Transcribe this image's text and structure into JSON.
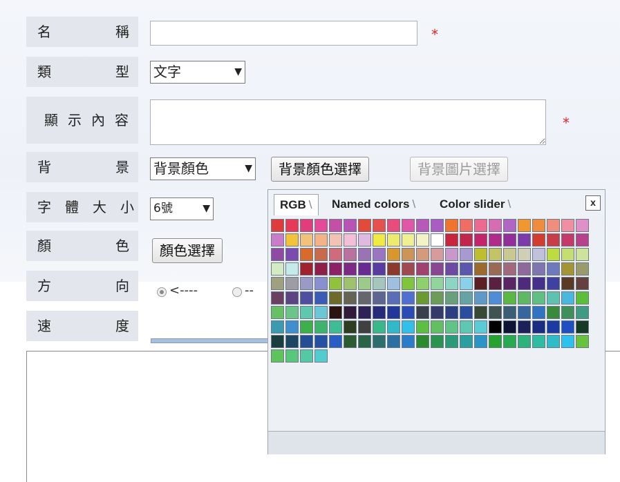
{
  "form": {
    "name": {
      "label_chars": [
        "名",
        "稱"
      ],
      "value": "",
      "required": "*"
    },
    "type": {
      "label_chars": [
        "類",
        "型"
      ],
      "selected": "文字",
      "arrow": "▼"
    },
    "content": {
      "label_chars": [
        "顯",
        "示",
        "內",
        "容"
      ],
      "value": "",
      "required": "*"
    },
    "background": {
      "label_chars": [
        "背",
        "景"
      ],
      "selected": "背景顏色",
      "arrow": "▼",
      "color_button": "背景顏色選擇",
      "image_button": "背景圖片選擇"
    },
    "font_size": {
      "label_chars": [
        "字",
        "體",
        "大",
        "小"
      ],
      "selected": "6號",
      "arrow": "▼"
    },
    "color": {
      "label_chars": [
        "顏",
        "色"
      ],
      "button": "顏色選擇"
    },
    "direction": {
      "label_chars": [
        "方",
        "向"
      ],
      "option1": "<----",
      "option2": "--"
    },
    "speed": {
      "label_chars": [
        "速",
        "度"
      ]
    }
  },
  "color_picker": {
    "tabs": [
      "RGB",
      "Named colors",
      "Color slider"
    ],
    "close": "x",
    "swatches": [
      "#e03b3b",
      "#e83a56",
      "#e23d7b",
      "#e44a99",
      "#c44fa6",
      "#b754b6",
      "#e34a3a",
      "#e6504d",
      "#e94b7d",
      "#e057a8",
      "#b858b8",
      "#a95cc2",
      "#f0732e",
      "#ef6d62",
      "#ec6991",
      "#d56cb4",
      "#b066c5",
      "#f0972f",
      "#f08c3e",
      "#f08e7d",
      "#ef8fa1",
      "#e08fc8",
      "#c97dc9",
      "#f2c23a",
      "#f0c27c",
      "#f3b387",
      "#f2c2b4",
      "#f2bfd7",
      "#e0b9e0",
      "#f0ea42",
      "#eeea6e",
      "#f0ef94",
      "#f4f3c5",
      "#ffffff",
      "#c9253d",
      "#c2264a",
      "#c3246b",
      "#b12c8a",
      "#932e9a",
      "#7c3ba8",
      "#d13d2f",
      "#c73e49",
      "#c53a69",
      "#b7418a",
      "#8f4aa3",
      "#7a4aae",
      "#d86a2b",
      "#c96a4d",
      "#d06c7a",
      "#bb71a0",
      "#9b73b5",
      "#9a76c2",
      "#d8962e",
      "#cd9457",
      "#d49a7b",
      "#d79b9b",
      "#c798c9",
      "#a79ad0",
      "#bfbe2e",
      "#c3c467",
      "#c9c98f",
      "#cfcfb8",
      "#c1c1dc",
      "#bcdc3f",
      "#c6dd73",
      "#cde39b",
      "#d3ebc2",
      "#c5eaea",
      "#a0222d",
      "#8e1f46",
      "#8e2166",
      "#7e2a85",
      "#6a2a93",
      "#5a3ba0",
      "#8c3a2a",
      "#a04a50",
      "#a0416f",
      "#8a4690",
      "#6c4aa1",
      "#5b56ae",
      "#9c6a2c",
      "#9a6a55",
      "#a2687c",
      "#8e6999",
      "#7f75b0",
      "#6f7abc",
      "#a49534",
      "#9b9a6c",
      "#a0a07f",
      "#9c9ca2",
      "#9a9ac4",
      "#8a8fd0",
      "#92c23c",
      "#a0c26c",
      "#9ccb89",
      "#a4c6bd",
      "#9fbfdf",
      "#7fc63c",
      "#8ed06c",
      "#93d39c",
      "#8ed4c4",
      "#8ad0e8",
      "#5e1f22",
      "#5a203f",
      "#5b2462",
      "#4f2a7b",
      "#45308c",
      "#3f41a0",
      "#5a3a23",
      "#64413f",
      "#6a3f5f",
      "#5c4482",
      "#4f4fa0",
      "#3b5cb4",
      "#6d6a2a",
      "#666553",
      "#66666d",
      "#5f6590",
      "#5a6db5",
      "#516fcf",
      "#6b9a33",
      "#6d9b58",
      "#67a07a",
      "#66a3a4",
      "#5f99c8",
      "#4f8ed6",
      "#5ab843",
      "#5fb862",
      "#60c083",
      "#5fc2b0",
      "#4ab7de",
      "#5bbf3a",
      "#68c065",
      "#6bc488",
      "#5fc7ad",
      "#6bc7d6",
      "#2a1412",
      "#321a3a",
      "#2d2155",
      "#282b7a",
      "#223797",
      "#2a4cb4",
      "#3a3f4d",
      "#343a6a",
      "#2c3f80",
      "#2a4d9e",
      "#384a36",
      "#3f5452",
      "#3a5f74",
      "#36669e",
      "#2f73c1",
      "#3a8a3c",
      "#3f8f5a",
      "#3f9c83",
      "#3b9ab0",
      "#3e8fd0",
      "#3eb04a",
      "#3db36c",
      "#3cbd96",
      "#2d3d1e",
      "#3f403f",
      "#3ab88a",
      "#30b9c9",
      "#33c0e8",
      "#5cbf42",
      "#63c062",
      "#62c387",
      "#5fc8b0",
      "#5ccbd8",
      "#000000",
      "#0f1434",
      "#1d215a",
      "#1a2d80",
      "#1b3ba3",
      "#1f4fc2",
      "#143a24",
      "#193e3e",
      "#1c4661",
      "#234e93",
      "#2651a3",
      "#285ec4",
      "#2b5c2f",
      "#2a6448",
      "#2d6e6d",
      "#2a70a0",
      "#2b7cc9",
      "#2b8a30",
      "#2a9350",
      "#2a9a77",
      "#2aa09e",
      "#2a94c7",
      "#26a32e",
      "#28aa52",
      "#2bb37b",
      "#30bba3",
      "#2ebdc8",
      "#2ec1f0",
      "#67c33c",
      "#5cc45a",
      "#58c77c",
      "#54c9a3",
      "#52cccc"
    ]
  }
}
